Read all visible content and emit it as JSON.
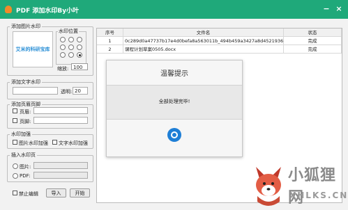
{
  "window": {
    "title": "PDF 添加水印By小叶",
    "minimize": "−",
    "close": "×"
  },
  "image_watermark": {
    "legend": "添加图片水印",
    "preview_text": "艾米的科研宝库",
    "position_legend": "水印位置",
    "zoom_label": "缩放:",
    "zoom_value": "100"
  },
  "text_watermark": {
    "legend": "添加文字水印",
    "text_value": "",
    "opacity_label": "透明:",
    "opacity_value": "20"
  },
  "header_footer": {
    "legend": "添加页眉页脚",
    "header_label": "页眉:",
    "footer_label": "页脚:"
  },
  "reinforce": {
    "legend": "水印加强",
    "image_label": "图片水印加强",
    "text_label": "文字水印加强"
  },
  "insert_page": {
    "legend": "插入水印页",
    "image_label": "图片:",
    "pdf_label": "PDF:"
  },
  "bottom": {
    "disable_edit_label": "禁止编辑",
    "import_button": "导入",
    "start_button": "开始"
  },
  "table": {
    "headers": [
      "序号",
      "文件名",
      "状态"
    ],
    "rows": [
      {
        "index": "1",
        "filename": "0c289d0a47737b17e4d0befa8a563011b_494b459a3427a8d4521936e714caf...",
        "status": "完成"
      },
      {
        "index": "2",
        "filename": "课程计划草案0505.docx",
        "status": "完成"
      }
    ]
  },
  "dialog": {
    "title": "温馨提示",
    "message": "全部处理完毕!"
  },
  "watermark_logo": {
    "text": "小狐狸网",
    "sub": "XHLKS.CN"
  }
}
